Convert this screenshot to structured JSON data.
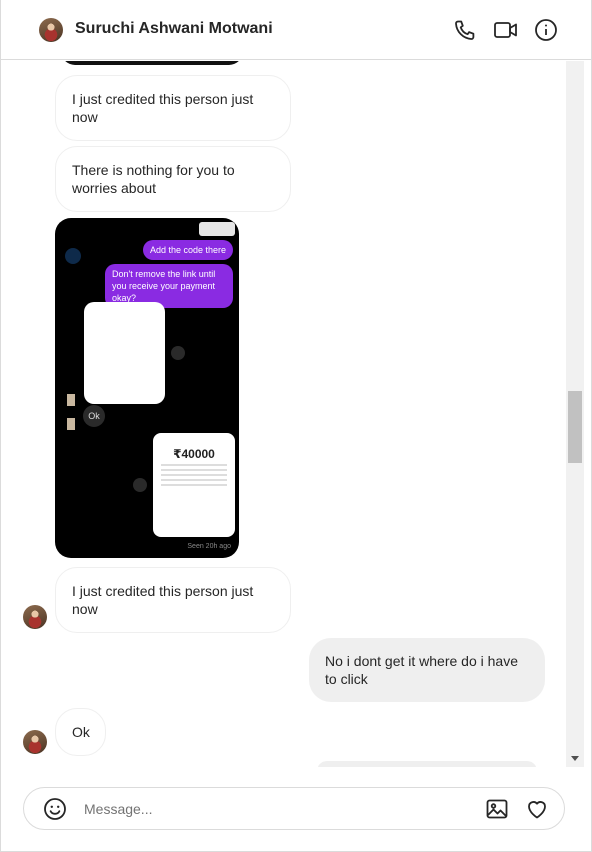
{
  "header": {
    "contact_name": "Suruchi Ashwani Motwani",
    "icons": [
      "phone-icon",
      "video-camera-icon",
      "info-icon"
    ]
  },
  "messages": [
    {
      "side": "in",
      "text": "I just credited this person just now"
    },
    {
      "side": "in",
      "text": "There is nothing for you to worries about"
    },
    {
      "side": "in",
      "type": "image",
      "image": {
        "bubble_1": "Add the code there",
        "bubble_2": "Don't remove the link until you receive your payment okay?",
        "ok": "Ok",
        "amount": "₹40000",
        "seen": "Seen 20h ago"
      }
    },
    {
      "side": "in",
      "text": "I just credited this person just now"
    },
    {
      "side": "out",
      "text": "No i dont get it where do i have to click"
    },
    {
      "side": "in",
      "text": "Ok"
    }
  ],
  "composer": {
    "placeholder": "Message...",
    "icons": [
      "emoji-icon",
      "image-icon",
      "heart-icon"
    ]
  },
  "colors": {
    "border": "#dbdbdb",
    "outgoing_bubble": "#efefef",
    "purple_bubble": "#8a2be2"
  }
}
